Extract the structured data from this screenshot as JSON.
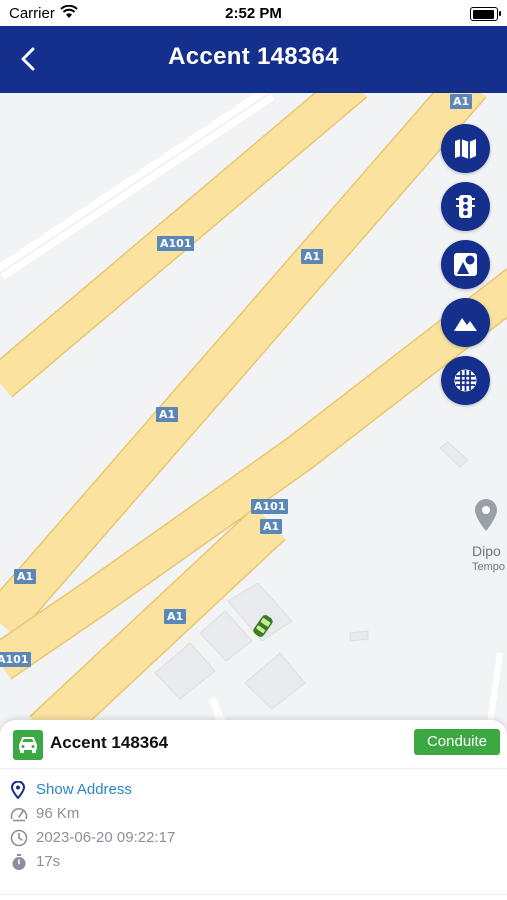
{
  "status_bar": {
    "carrier": "Carrier",
    "time": "2:52 PM"
  },
  "nav": {
    "title": "Accent 148364"
  },
  "map": {
    "road_labels": [
      "A1",
      "A101",
      "A1",
      "A1",
      "A101",
      "A1",
      "A1",
      "A1",
      "A101"
    ],
    "poi": {
      "name": "Dipo",
      "subtitle": "Tempo"
    }
  },
  "map_controls": [
    "map-type-icon",
    "traffic-light-icon",
    "shapes-icon",
    "terrain-icon",
    "grid-icon"
  ],
  "colors": {
    "primary": "#142f8c",
    "status_green": "#3ca843",
    "link_blue": "#2a86c8",
    "road": "#fbe29f"
  },
  "vehicle": {
    "name": "Accent 148364",
    "status": "Conduite",
    "address_link": "Show Address",
    "speed": "96 Km",
    "timestamp": "2023-06-20 09:22:17",
    "duration": "17s"
  }
}
